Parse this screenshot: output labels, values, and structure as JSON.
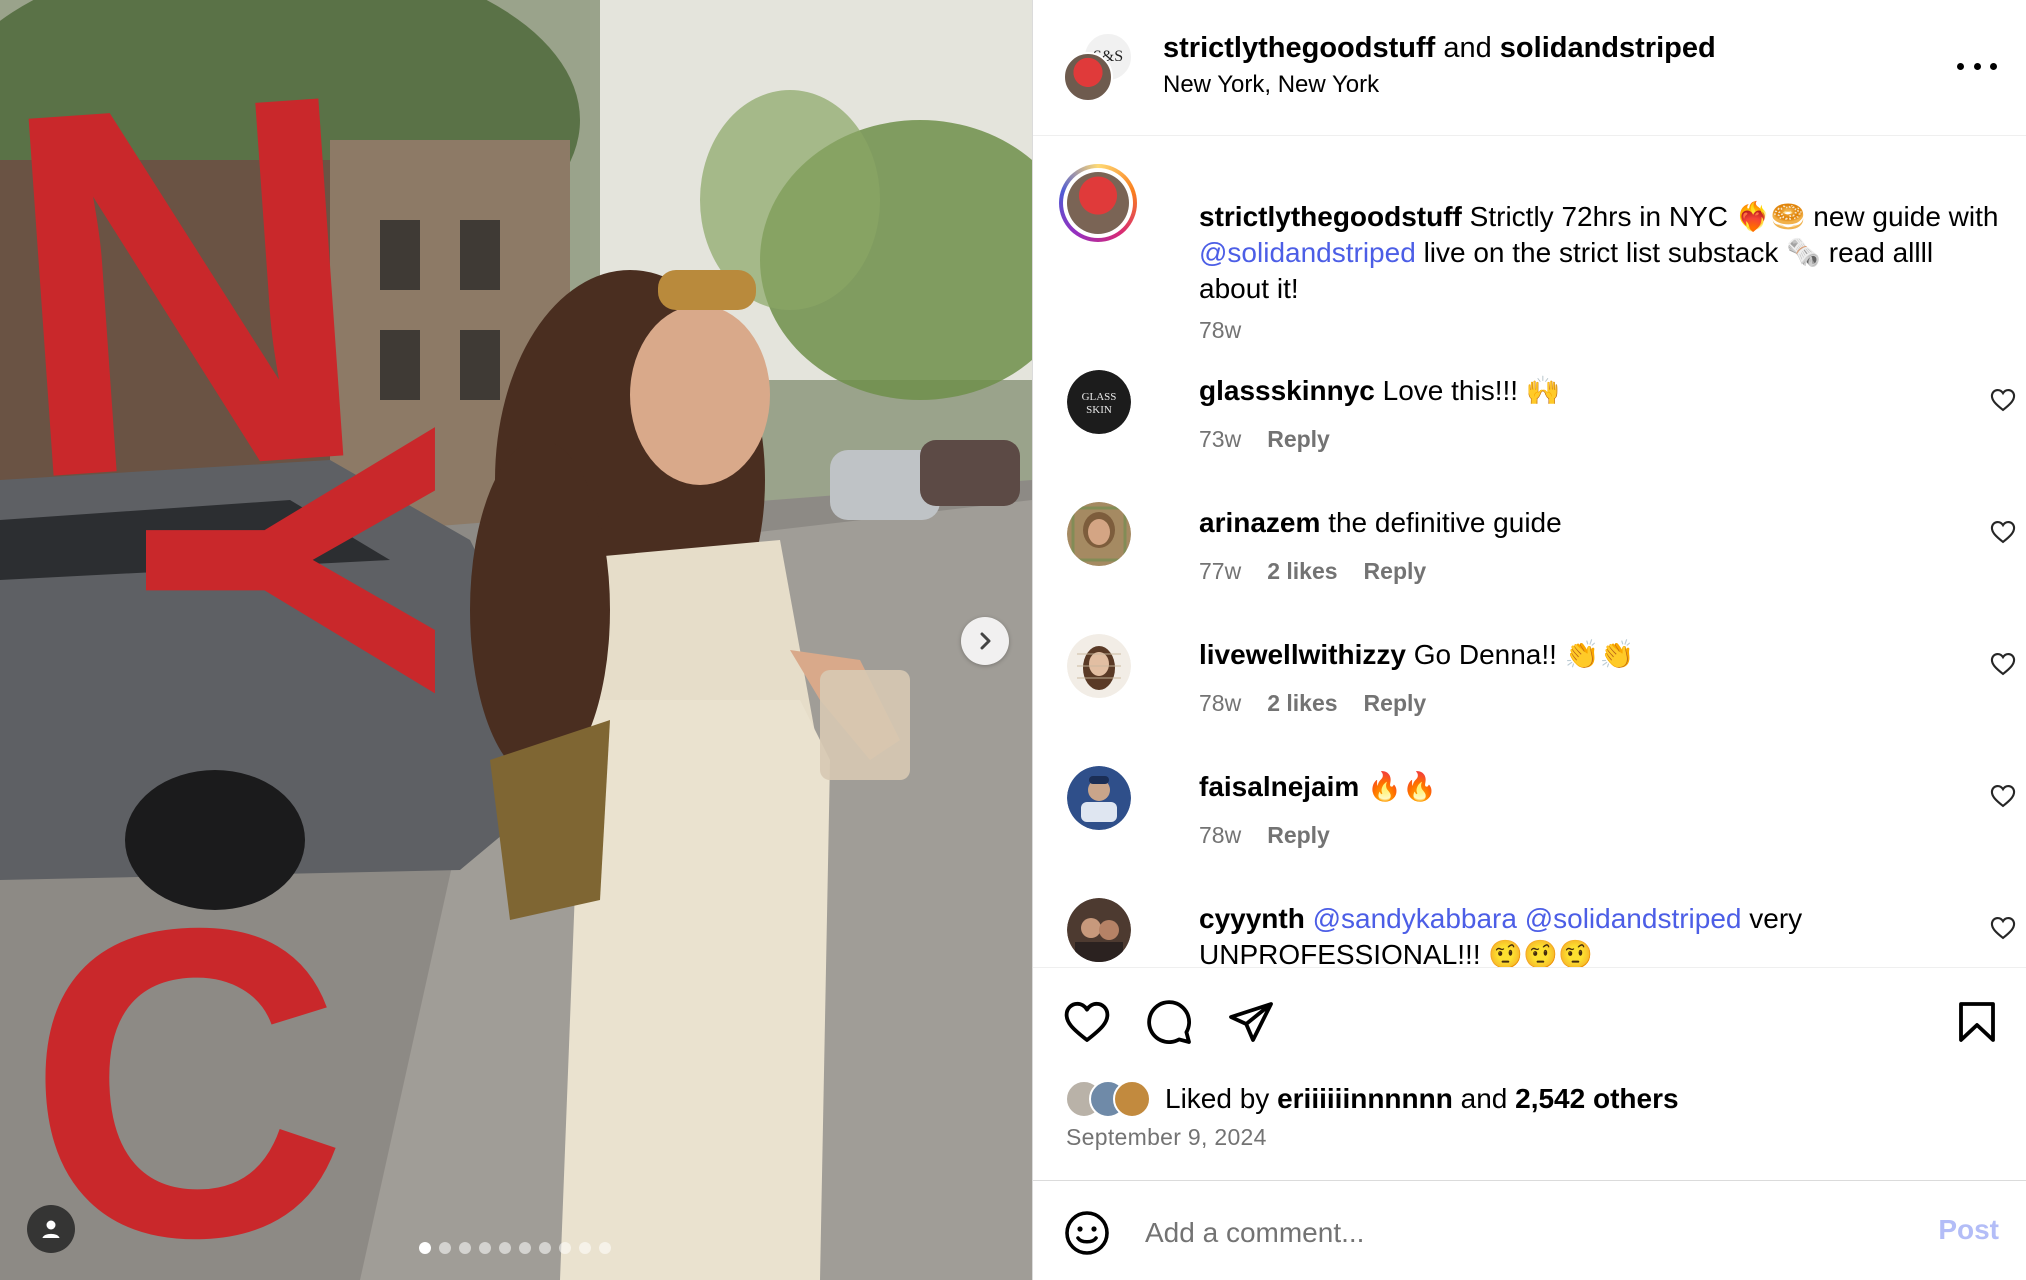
{
  "post": {
    "media": {
      "overlay_text": [
        "N",
        "Y",
        "C"
      ],
      "current_slide": 1,
      "total_slides": 10
    },
    "header": {
      "author": "strictlythegoodstuff",
      "connector": "and",
      "collaborator": "solidandstriped",
      "location": "New York, New York",
      "collab_avatar_text": "S&S"
    },
    "caption": {
      "username": "strictlythegoodstuff",
      "text_part1": "Strictly 72hrs in NYC ❤️‍🔥🥯 new guide with",
      "mention": "@solidandstriped",
      "text_part2": "live on the strict list substack 🗞️ read allll about it!",
      "time": "78w"
    },
    "comments": [
      {
        "username": "glassskinnyc",
        "text": "Love this!!! 🙌",
        "time": "73w",
        "likes": "",
        "reply": "Reply",
        "avatar_text": "GLASS SKIN"
      },
      {
        "username": "arinazem",
        "text": "the definitive guide",
        "time": "77w",
        "likes": "2 likes",
        "reply": "Reply"
      },
      {
        "username": "livewellwithizzy",
        "text": "Go Denna!! 👏👏",
        "time": "78w",
        "likes": "2 likes",
        "reply": "Reply"
      },
      {
        "username": "faisalnejaim",
        "text": "🔥🔥",
        "time": "78w",
        "likes": "",
        "reply": "Reply"
      },
      {
        "username": "cyyynth",
        "mention1": "@sandykabbara",
        "mention2": "@solidandstriped",
        "text": "very UNPROFESSIONAL!!! 🤨🤨🤨",
        "time": "",
        "likes": "",
        "reply": ""
      }
    ],
    "likes": {
      "prefix": "Liked by",
      "liker": "eriiiiiinnnnnn",
      "connector": "and",
      "others": "2,542 others"
    },
    "date": "September 9, 2024",
    "add_comment": {
      "placeholder": "Add a comment...",
      "post_label": "Post"
    }
  },
  "icons": {
    "like": "heart-icon",
    "comment": "comment-bubble-icon",
    "share": "paper-plane-icon",
    "save": "bookmark-icon",
    "emoji": "smiley-icon",
    "more": "more-options-icon",
    "next": "chevron-right-icon",
    "tag": "user-tag-icon"
  },
  "colors": {
    "overlay_red": "#c9282b",
    "link_blue": "#4c5ee6",
    "muted_text": "#737373",
    "post_button_disabled": "#b3bdf7"
  }
}
